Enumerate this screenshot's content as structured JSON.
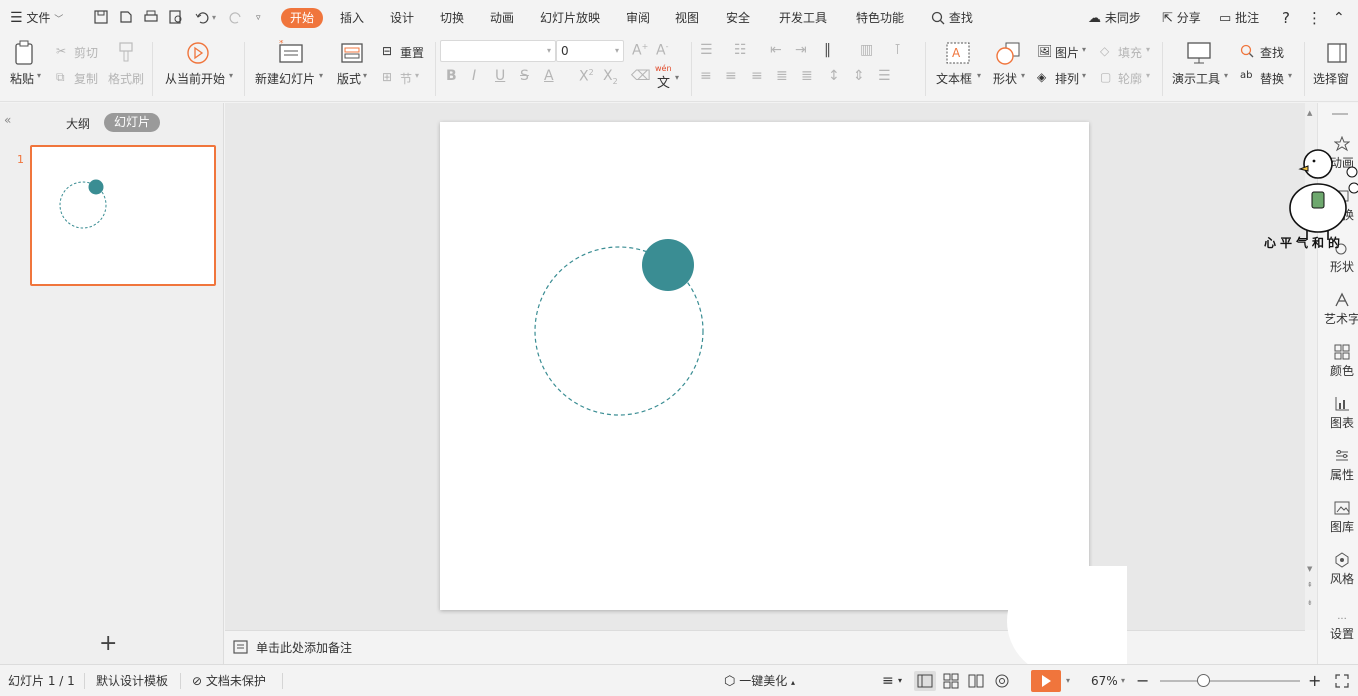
{
  "menubar": {
    "file_label": "文件",
    "tabs": [
      {
        "label": "开始",
        "active": true
      },
      {
        "label": "插入"
      },
      {
        "label": "设计"
      },
      {
        "label": "切换"
      },
      {
        "label": "动画"
      },
      {
        "label": "幻灯片放映"
      },
      {
        "label": "审阅"
      },
      {
        "label": "视图"
      },
      {
        "label": "安全"
      },
      {
        "label": "开发工具"
      },
      {
        "label": "特色功能"
      }
    ],
    "search_label": "查找",
    "sync_label": "未同步",
    "share_label": "分享",
    "comment_label": "批注"
  },
  "ribbon": {
    "paste": "粘贴",
    "cut": "剪切",
    "copy": "复制",
    "format_painter": "格式刷",
    "from_current": "从当前开始",
    "new_slide": "新建幻灯片",
    "layout": "版式",
    "reset": "重置",
    "section": "节",
    "font_name": "",
    "font_size": "0",
    "wen": "wén",
    "wen_char": "文",
    "textbox": "文本框",
    "shape": "形状",
    "picture": "图片",
    "fill": "填充",
    "arrange": "排列",
    "outline": "轮廓",
    "presenter_tools": "演示工具",
    "find": "查找",
    "replace": "替换",
    "select_pane": "选择窗"
  },
  "leftpanel": {
    "outline_tab": "大纲",
    "slides_tab": "幻灯片",
    "slide_number": "1",
    "add_label": "+"
  },
  "notes": {
    "placeholder": "单击此处添加备注"
  },
  "rightbar": {
    "items": [
      "动画",
      "切换",
      "形状",
      "艺术字",
      "颜色",
      "图表",
      "属性",
      "图库",
      "风格",
      "设置"
    ]
  },
  "watermark": {
    "text": "心平气和的"
  },
  "statusbar": {
    "slide_info": "幻灯片 1 / 1",
    "template": "默认设计模板",
    "protection": "文档未保护",
    "beautify": "一键美化",
    "zoom": "67%"
  },
  "colors": {
    "accent": "#f0753c",
    "teal": "#3a8d93"
  }
}
